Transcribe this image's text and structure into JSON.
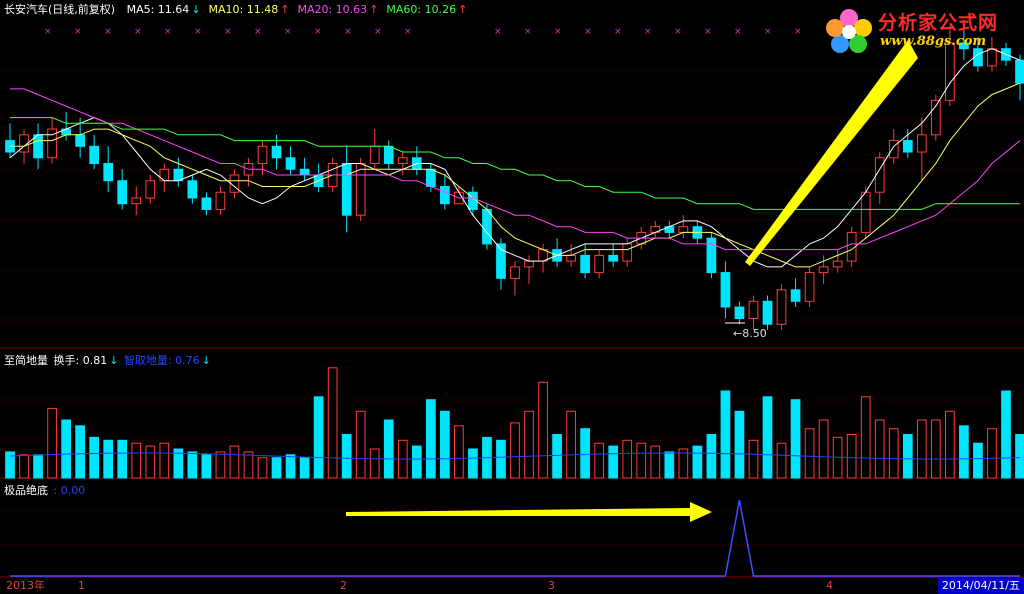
{
  "window_title": "长安汽车(日线,前复权)",
  "ma_legend": [
    {
      "label": "MA5: 11.64",
      "arrow": "↓",
      "color": "#ffffff"
    },
    {
      "label": "MA10: 11.48",
      "arrow": "↑",
      "color": "#ffff66"
    },
    {
      "label": "MA20: 10.63",
      "arrow": "↑",
      "color": "#ff44ff"
    },
    {
      "label": "MA60: 10.26",
      "arrow": "↑",
      "color": "#44ff44"
    }
  ],
  "volume_panel": {
    "title": "至简地量",
    "turnover": "换手: 0.81",
    "turnover_arrow": "↓",
    "indicator": "智取地量: 0.76",
    "indicator_arrow": "↓"
  },
  "signal_panel": {
    "title": "极品绝底",
    "value": ": 0.00"
  },
  "low_label": "←8.50",
  "logo": {
    "name": "分析家公式网",
    "url": "www.88gs.com"
  },
  "x_axis": {
    "labels": [
      "2013年",
      "1",
      "2",
      "3",
      "4"
    ],
    "current_date": "2014/04/11/五"
  },
  "colors": {
    "up": "#ff3c3c",
    "down": "#00e5ff",
    "ma5": "#ffffff",
    "ma10": "#ffff66",
    "ma20": "#ff44ff",
    "ma60": "#44ff44",
    "volume_avg": "#2244ff",
    "signal": "#3355ff",
    "arrow": "#ffff00",
    "grid": "#8b0000"
  },
  "chart_data": [
    {
      "type": "candlestick",
      "title": "长安汽车(日线,前复权)",
      "series": [
        {
          "name": "MA5",
          "values": [
            10.6,
            10.8,
            11.0,
            11.0,
            11.1,
            11.2,
            11.3,
            11.2,
            11.0,
            10.7,
            10.4,
            10.2,
            10.2,
            10.3,
            10.4,
            10.3,
            10.1,
            9.9,
            9.8,
            9.9,
            10.1,
            10.2,
            10.3,
            10.4,
            10.5,
            10.5,
            10.4,
            10.3,
            10.4,
            10.5,
            10.5,
            10.4,
            10.0,
            9.6,
            9.3,
            9.0,
            8.9,
            8.8,
            8.8,
            8.9,
            9.0,
            9.1,
            9.1,
            9.1,
            9.1,
            9.2,
            9.3,
            9.4,
            9.5,
            9.5,
            9.4,
            9.2,
            9.0,
            8.8,
            8.7,
            8.7,
            8.9,
            9.1,
            9.2,
            9.4,
            9.7,
            10.0,
            10.4,
            10.8,
            11.0,
            11.2,
            11.5,
            11.9,
            12.2,
            12.4,
            12.5,
            12.4,
            12.3
          ]
        },
        {
          "name": "MA10",
          "values": [
            10.8,
            10.8,
            10.9,
            10.9,
            11.0,
            11.0,
            11.1,
            11.1,
            11.0,
            10.9,
            10.8,
            10.6,
            10.5,
            10.4,
            10.3,
            10.2,
            10.2,
            10.2,
            10.1,
            10.1,
            10.1,
            10.1,
            10.2,
            10.3,
            10.3,
            10.4,
            10.4,
            10.4,
            10.4,
            10.4,
            10.4,
            10.3,
            10.1,
            9.9,
            9.7,
            9.4,
            9.2,
            9.1,
            9.0,
            8.9,
            8.9,
            9.0,
            9.0,
            9.0,
            9.0,
            9.1,
            9.2,
            9.2,
            9.3,
            9.3,
            9.3,
            9.2,
            9.1,
            9.0,
            8.9,
            8.8,
            8.7,
            8.7,
            8.8,
            8.9,
            9.0,
            9.2,
            9.4,
            9.6,
            9.9,
            10.2,
            10.5,
            10.9,
            11.2,
            11.5,
            11.7,
            11.8,
            11.9
          ]
        },
        {
          "name": "MA20",
          "values": [
            11.8,
            11.8,
            11.7,
            11.6,
            11.5,
            11.4,
            11.3,
            11.2,
            11.2,
            11.1,
            11.0,
            10.9,
            10.8,
            10.7,
            10.6,
            10.5,
            10.5,
            10.4,
            10.4,
            10.3,
            10.3,
            10.3,
            10.3,
            10.3,
            10.3,
            10.3,
            10.3,
            10.3,
            10.2,
            10.2,
            10.1,
            10.0,
            9.9,
            9.9,
            9.8,
            9.7,
            9.6,
            9.6,
            9.5,
            9.4,
            9.4,
            9.3,
            9.3,
            9.3,
            9.2,
            9.2,
            9.2,
            9.2,
            9.1,
            9.1,
            9.1,
            9.0,
            9.0,
            9.0,
            9.0,
            9.0,
            9.0,
            9.0,
            9.0,
            9.0,
            9.1,
            9.1,
            9.2,
            9.3,
            9.4,
            9.5,
            9.6,
            9.8,
            10.0,
            10.2,
            10.5,
            10.7,
            10.9
          ]
        },
        {
          "name": "MA60",
          "values": [
            11.3,
            11.3,
            11.3,
            11.3,
            11.2,
            11.2,
            11.2,
            11.2,
            11.1,
            11.1,
            11.1,
            11.1,
            11.0,
            11.0,
            11.0,
            11.0,
            10.9,
            10.9,
            10.9,
            10.9,
            10.9,
            10.9,
            10.8,
            10.8,
            10.8,
            10.8,
            10.8,
            10.8,
            10.7,
            10.7,
            10.7,
            10.6,
            10.6,
            10.5,
            10.5,
            10.4,
            10.4,
            10.3,
            10.3,
            10.2,
            10.2,
            10.1,
            10.1,
            10.0,
            10.0,
            10.0,
            9.9,
            9.9,
            9.9,
            9.8,
            9.8,
            9.8,
            9.8,
            9.7,
            9.7,
            9.7,
            9.7,
            9.7,
            9.7,
            9.7,
            9.7,
            9.7,
            9.7,
            9.7,
            9.7,
            9.7,
            9.8,
            9.8,
            9.8,
            9.8,
            9.8,
            9.8,
            9.8
          ]
        }
      ],
      "candles": [
        [
          10.9,
          11.2,
          10.6,
          10.7
        ],
        [
          10.7,
          11.1,
          10.5,
          11.0
        ],
        [
          11.0,
          11.2,
          10.4,
          10.6
        ],
        [
          10.6,
          11.3,
          10.5,
          11.1
        ],
        [
          11.1,
          11.4,
          10.9,
          11.0
        ],
        [
          11.0,
          11.3,
          10.6,
          10.8
        ],
        [
          10.8,
          11.0,
          10.4,
          10.5
        ],
        [
          10.5,
          10.8,
          10.0,
          10.2
        ],
        [
          10.2,
          10.4,
          9.7,
          9.8
        ],
        [
          9.8,
          10.1,
          9.6,
          9.9
        ],
        [
          9.9,
          10.3,
          9.8,
          10.2
        ],
        [
          10.2,
          10.5,
          10.0,
          10.4
        ],
        [
          10.4,
          10.6,
          10.1,
          10.2
        ],
        [
          10.2,
          10.3,
          9.8,
          9.9
        ],
        [
          9.9,
          10.0,
          9.6,
          9.7
        ],
        [
          9.7,
          10.1,
          9.6,
          10.0
        ],
        [
          10.0,
          10.4,
          9.9,
          10.3
        ],
        [
          10.3,
          10.6,
          10.1,
          10.5
        ],
        [
          10.5,
          10.9,
          10.3,
          10.8
        ],
        [
          10.8,
          11.0,
          10.4,
          10.6
        ],
        [
          10.6,
          10.8,
          10.3,
          10.4
        ],
        [
          10.4,
          10.6,
          10.2,
          10.3
        ],
        [
          10.3,
          10.5,
          10.0,
          10.1
        ],
        [
          10.1,
          10.6,
          10.0,
          10.5
        ],
        [
          10.5,
          10.8,
          9.3,
          9.6
        ],
        [
          9.6,
          10.6,
          9.5,
          10.5
        ],
        [
          10.5,
          11.1,
          10.4,
          10.8
        ],
        [
          10.8,
          10.9,
          10.4,
          10.5
        ],
        [
          10.5,
          10.7,
          10.3,
          10.6
        ],
        [
          10.6,
          10.8,
          10.3,
          10.4
        ],
        [
          10.4,
          10.5,
          10.0,
          10.1
        ],
        [
          10.1,
          10.3,
          9.7,
          9.8
        ],
        [
          9.8,
          10.1,
          9.8,
          10.0
        ],
        [
          10.0,
          10.1,
          9.6,
          9.7
        ],
        [
          9.7,
          9.8,
          9.0,
          9.1
        ],
        [
          9.1,
          9.2,
          8.3,
          8.5
        ],
        [
          8.5,
          8.8,
          8.2,
          8.7
        ],
        [
          8.7,
          8.9,
          8.4,
          8.8
        ],
        [
          8.8,
          9.1,
          8.6,
          9.0
        ],
        [
          9.0,
          9.2,
          8.7,
          8.8
        ],
        [
          8.8,
          9.1,
          8.7,
          8.9
        ],
        [
          8.9,
          9.1,
          8.5,
          8.6
        ],
        [
          8.6,
          9.0,
          8.5,
          8.9
        ],
        [
          8.9,
          9.1,
          8.7,
          8.8
        ],
        [
          8.8,
          9.2,
          8.7,
          9.1
        ],
        [
          9.1,
          9.4,
          9.0,
          9.3
        ],
        [
          9.3,
          9.5,
          9.2,
          9.4
        ],
        [
          9.4,
          9.5,
          9.2,
          9.3
        ],
        [
          9.3,
          9.6,
          9.2,
          9.4
        ],
        [
          9.4,
          9.5,
          9.1,
          9.2
        ],
        [
          9.2,
          9.3,
          8.5,
          8.6
        ],
        [
          8.6,
          8.8,
          7.8,
          8.0
        ],
        [
          8.0,
          8.1,
          7.7,
          7.8
        ],
        [
          7.8,
          8.2,
          7.6,
          8.1
        ],
        [
          8.1,
          8.2,
          7.6,
          7.7
        ],
        [
          7.7,
          8.4,
          7.6,
          8.3
        ],
        [
          8.3,
          8.5,
          8.0,
          8.1
        ],
        [
          8.1,
          8.7,
          8.0,
          8.6
        ],
        [
          8.6,
          8.9,
          8.4,
          8.7
        ],
        [
          8.7,
          9.0,
          8.6,
          8.8
        ],
        [
          8.8,
          9.4,
          8.7,
          9.3
        ],
        [
          9.3,
          10.1,
          9.2,
          10.0
        ],
        [
          10.0,
          10.7,
          9.8,
          10.6
        ],
        [
          10.6,
          11.1,
          10.5,
          10.9
        ],
        [
          10.9,
          11.1,
          10.6,
          10.7
        ],
        [
          10.7,
          11.3,
          10.2,
          11.0
        ],
        [
          11.0,
          11.7,
          10.9,
          11.6
        ],
        [
          11.6,
          12.9,
          11.5,
          12.6
        ],
        [
          12.6,
          13.0,
          12.3,
          12.5
        ],
        [
          12.5,
          12.7,
          12.1,
          12.2
        ],
        [
          12.2,
          12.7,
          12.1,
          12.5
        ],
        [
          12.5,
          12.6,
          12.2,
          12.3
        ],
        [
          12.3,
          12.4,
          11.6,
          11.9
        ]
      ],
      "low_label": "8.50"
    },
    {
      "type": "bar",
      "title": "至简地量",
      "values": [
        18,
        16,
        16,
        48,
        40,
        36,
        28,
        26,
        26,
        24,
        22,
        24,
        20,
        18,
        16,
        18,
        22,
        18,
        14,
        14,
        16,
        14,
        56,
        76,
        30,
        46,
        20,
        40,
        26,
        22,
        54,
        46,
        36,
        20,
        28,
        26,
        38,
        46,
        66,
        30,
        46,
        34,
        24,
        22,
        26,
        24,
        22,
        18,
        20,
        22,
        30,
        60,
        46,
        26,
        56,
        24,
        54,
        34,
        40,
        28,
        30,
        56,
        40,
        34,
        30,
        40,
        40,
        46,
        36,
        24,
        34,
        60,
        30
      ],
      "average": 0.76
    },
    {
      "type": "line",
      "title": "极品绝底",
      "values": [
        0,
        0,
        0,
        0,
        0,
        0,
        0,
        0,
        0,
        0,
        0,
        0,
        0,
        0,
        0,
        0,
        0,
        0,
        0,
        0,
        0,
        0,
        0,
        0,
        0,
        0,
        0,
        0,
        0,
        0,
        0,
        0,
        0,
        0,
        0,
        0,
        0,
        0,
        0,
        0,
        0,
        0,
        0,
        0,
        0,
        0,
        0,
        0,
        0,
        0,
        0,
        0,
        1,
        0,
        0,
        0,
        0,
        0,
        0,
        0,
        0,
        0,
        0,
        0,
        0,
        0,
        0,
        0,
        0,
        0,
        0,
        0,
        0
      ]
    }
  ]
}
